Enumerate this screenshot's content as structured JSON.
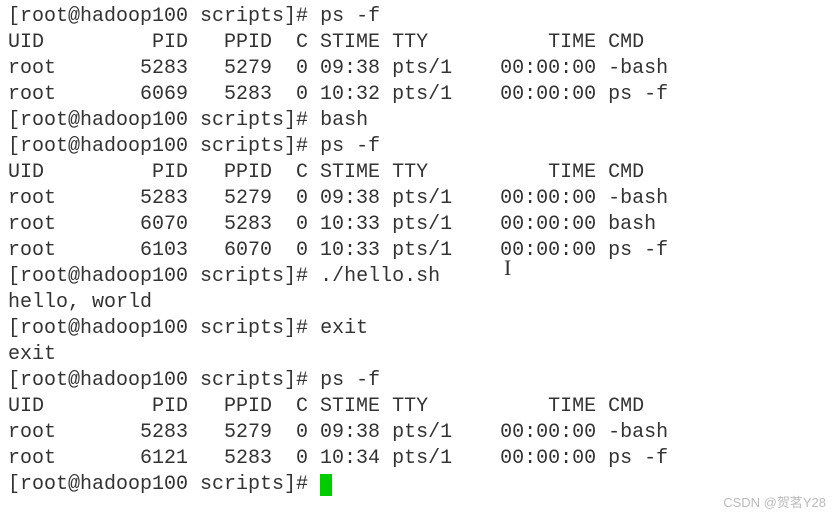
{
  "prompt": "[root@hadoop100 scripts]# ",
  "commands": {
    "ps_f": "ps -f",
    "bash": "bash",
    "hello": "./hello.sh",
    "exit": "exit"
  },
  "ps_header": "UID         PID   PPID  C STIME TTY          TIME CMD",
  "output": {
    "hello_world": "hello, world",
    "exit_echo": "exit"
  },
  "ps1": {
    "rows": [
      "root       5283   5279  0 09:38 pts/1    00:00:00 -bash",
      "root       6069   5283  0 10:32 pts/1    00:00:00 ps -f"
    ]
  },
  "ps2": {
    "rows": [
      "root       5283   5279  0 09:38 pts/1    00:00:00 -bash",
      "root       6070   5283  0 10:33 pts/1    00:00:00 bash",
      "root       6103   6070  0 10:33 pts/1    00:00:00 ps -f"
    ]
  },
  "ps3": {
    "rows": [
      "root       5283   5279  0 09:38 pts/1    00:00:00 -bash",
      "root       6121   5283  0 10:34 pts/1    00:00:00 ps -f"
    ]
  },
  "watermark": "CSDN @贺茗Y28"
}
